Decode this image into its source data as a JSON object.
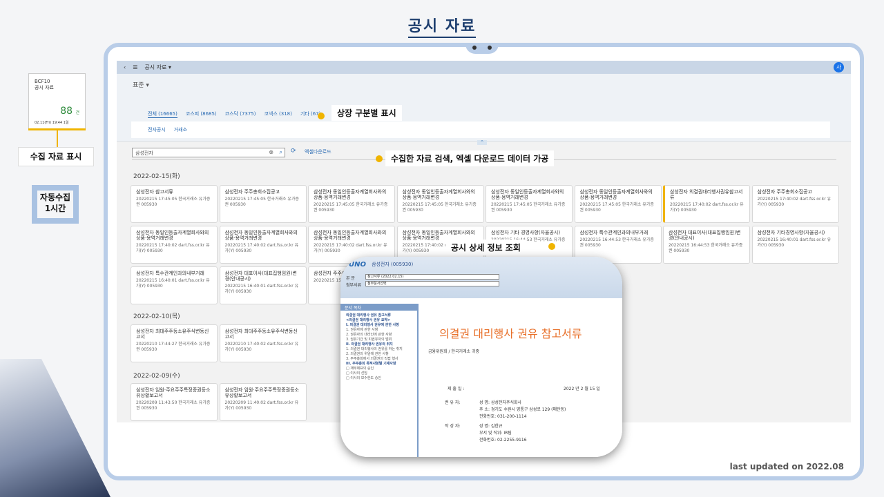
{
  "page_title": "공시 자료",
  "widget": {
    "line1": "BCF10",
    "line2": "공시 자료",
    "count": "88",
    "unit": "건",
    "footer": "02.11(Fri) 19:44 1일"
  },
  "left_labels": {
    "collect_display": "수집 자료 표시",
    "auto_collect": "자동수집",
    "interval": "1시간"
  },
  "callouts": {
    "listing": "상장 구분별 표시",
    "search": "수집한 자료 검색, 엑셀 다운로드 데이터 가공",
    "detail": "공시 상세 정보 조회"
  },
  "shell": {
    "back": "‹",
    "menu": "☰",
    "title": "공시 자료 ▾",
    "user": "사"
  },
  "header": {
    "variant": "표준 ▾",
    "collapse": "^"
  },
  "tabs": [
    "전체 (16665)",
    "코스피 (8685)",
    "코스닥 (7375)",
    "코넥스 (318)",
    "기타 (67)"
  ],
  "subtabs": [
    "전자공시",
    "거래소"
  ],
  "toolbar": {
    "search_value": "삼성전자",
    "clear": "⊗",
    "search": "⌕",
    "refresh": "⟳",
    "excel": "엑셀다운로드"
  },
  "dates": [
    "2022-02-15(화)",
    "2022-02-10(목)",
    "2022-02-09(수)"
  ],
  "cards_row1": [
    {
      "t": "삼성전자 참고서류",
      "m": "20220215 17:45:05 한국거래소 유가증권 005930"
    },
    {
      "t": "삼성전자 주주총회소집공고",
      "m": "20220215 17:45:05 한국거래소 유가증권 005930"
    },
    {
      "t": "삼성전자 동일인등출자계열회사와의상품·용역거래변경",
      "m": "20220215 17:45:05 한국거래소 유가증권 005930"
    },
    {
      "t": "삼성전자 동일인등출자계열회사와의상품·용역거래변경",
      "m": "20220215 17:45:05 한국거래소 유가증권 005930"
    },
    {
      "t": "삼성전자 동일인등출자계열회사와의상품·용역거래변경",
      "m": "20220215 17:45:05 한국거래소 유가증권 005930"
    },
    {
      "t": "삼성전자 동일인등출자계열회사와의상품·용역거래변경",
      "m": "20220215 17:45:05 한국거래소 유가증권 005930"
    },
    {
      "t": "삼성전자 의결권대리행사권유참고서류",
      "m": "20220215 17:40:02 dart.fss.or.kr 유가(Y) 005930"
    },
    {
      "t": "삼성전자 주주총회소집공고",
      "m": "20220215 17:40:02 dart.fss.or.kr 유가(Y) 005930"
    }
  ],
  "cards_row2": [
    {
      "t": "삼성전자 동일인등출자계열회사와의상품·용역거래변경",
      "m": "20220215 17:40:02 dart.fss.or.kr 유가(Y) 005930"
    },
    {
      "t": "삼성전자 동일인등출자계열회사와의상품·용역거래변경",
      "m": "20220215 17:40:02 dart.fss.or.kr 유가(Y) 005930"
    },
    {
      "t": "삼성전자 동일인등출자계열회사와의상품·용역거래변경",
      "m": "20220215 17:40:02 dart.fss.or.kr 유가(Y) 005930"
    },
    {
      "t": "삼성전자 동일인등출자계열회사와의상품·용역거래변경",
      "m": "20220215 17:40:02 dart.fss.or.kr 유가(Y) 005930"
    },
    {
      "t": "삼성전자 기타 경영사항(자율공시)",
      "m": "20220215 16:44:53 한국거래소 유가증권 005930"
    },
    {
      "t": "삼성전자 특수관계인과의내부거래",
      "m": "20220215 16:44:53 한국거래소 유가증권 005930"
    },
    {
      "t": "삼성전자 대표이사(대표집행임원)변경(안내공시)",
      "m": "20220215 16:44:53 한국거래소 유가증권 005930"
    },
    {
      "t": "삼성전자 기타경영사항(자율공시)",
      "m": "20220215 16:40:01 dart.fss.or.kr 유가(Y) 005930"
    }
  ],
  "cards_row3": [
    {
      "t": "삼성전자 특수관계인과의내부거래",
      "m": "20220215 16:40:01 dart.fss.or.kr 유가(Y) 005930"
    },
    {
      "t": "삼성전자 대표이사(대표집행임원)변경(안내공시)",
      "m": "20220215 16:40:01 dart.fss.or.kr 유가(Y) 005930"
    },
    {
      "t": "삼성전자 주주총회",
      "m": "20220215 15:4 증권 005930"
    }
  ],
  "cards_feb10": [
    {
      "t": "삼성전자 최대주주등소유주식변동신고서",
      "m": "20220210 17:44:27 한국거래소 유가증권 005930"
    },
    {
      "t": "삼성전자 최대주주등소유주식변동신고서",
      "m": "20220210 17:40:02 dart.fss.or.kr 유가(Y) 005930"
    }
  ],
  "cards_feb09": [
    {
      "t": "삼성전자 임원·주요주주특정증권등소유상황보고서",
      "m": "20220209 11:43:50 한국거래소 유가증권 005930"
    },
    {
      "t": "삼성전자 임원·주요주주특정증권등소유상황보고서",
      "m": "20220209 11:40:02 dart.fss.or.kr 유가(Y) 005930"
    }
  ],
  "popup": {
    "logo": "UNO",
    "company": "삼성전자 (005930)",
    "label_doc": "본 문",
    "sel_doc": "참고서류 (2022.02.15)",
    "label_attach": "첨부서류",
    "sel_attach": "첨부문서선택",
    "toc_title": "문서 목차",
    "toc": [
      {
        "text": "의결권 대리행사 권유 참고서류",
        "b": true
      },
      {
        "text": "<의결권 대리행사 권유 요약>",
        "b": true
      },
      {
        "text": "I. 의결권 대리행사 권유에 관한 사항",
        "b": true
      },
      {
        "text": "1. 권유자에 관한 사항",
        "b": false
      },
      {
        "text": "2. 권유자의 대리인에 관한 사항",
        "b": false
      },
      {
        "text": "3. 권유기간 및 피권유자의 범위",
        "b": false
      },
      {
        "text": "II. 의결권 대리행사 권유의 취지",
        "b": true
      },
      {
        "text": "1. 의결권 대리행사의 권유를 하는 취지",
        "b": false
      },
      {
        "text": "2. 의결권의 위임에 관한 사항",
        "b": false
      },
      {
        "text": "3. 주주총회에서 의결권의 직접 행사",
        "b": false
      },
      {
        "text": "III. 주주총회 목적사항별 기재사항",
        "b": true
      },
      {
        "text": "□ 재무제표의 승인",
        "b": false
      },
      {
        "text": "□ 이사의 선임",
        "b": false
      },
      {
        "text": "□ 이사의 보수한도 승인",
        "b": false
      }
    ],
    "doc_title": "의결권 대리행사 권유 참고서류",
    "doc_sub": "금융위원회 / 한국거래소 귀중",
    "date_label": "제 출 일 :",
    "date_value": "2022 년   2 월   15 일",
    "req_label": "권 유 자:",
    "req_lines": [
      "성 명: 삼성전자주식회사",
      "주 소: 경기도 수원시 영통구 삼성로 129 (매탄동)",
      "전화번호: 031-200-1114"
    ],
    "writer_label": "작 성 자:",
    "writer_lines": [
      "성 명: 김한규",
      "부서 및 직위: IR팀",
      "전화번호: 02-2255-9116"
    ]
  },
  "footer": "last updated on 2022.08"
}
